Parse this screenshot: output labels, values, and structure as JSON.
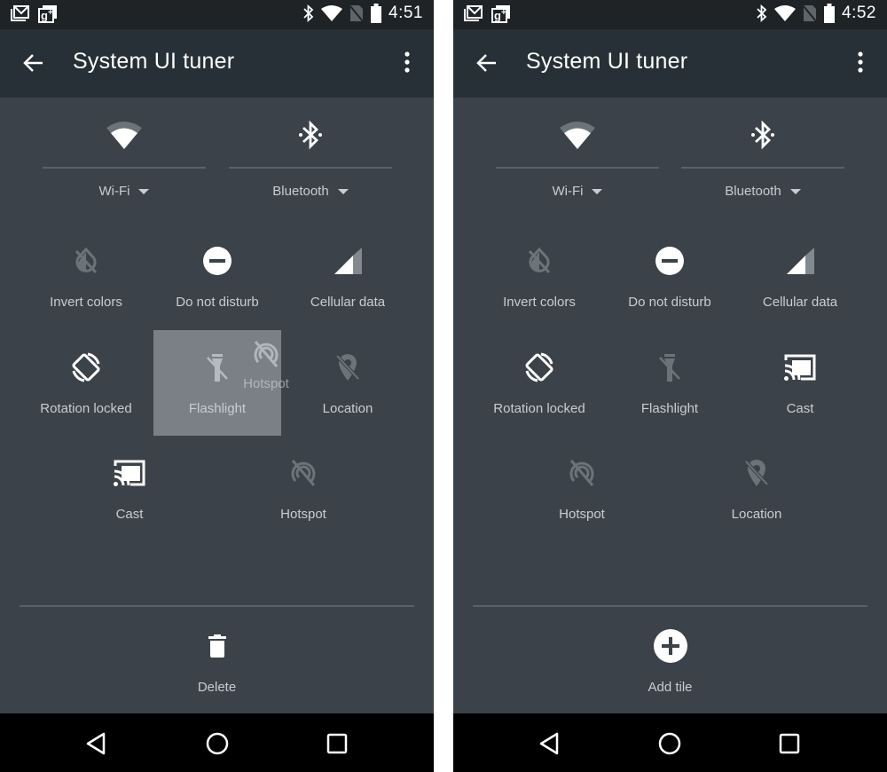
{
  "screens": [
    {
      "statusbar": {
        "time": "4:51",
        "notification_icons": [
          "gmail-icon",
          "google-plus-icon"
        ],
        "status_icons": [
          "bluetooth-icon",
          "wifi-icon",
          "no-sim-icon",
          "battery-icon"
        ]
      },
      "toolbar": {
        "title": "System UI tuner",
        "back_icon": "arrow-back-icon",
        "menu_icon": "more-vert-icon"
      },
      "big_tiles": [
        {
          "label": "Wi-Fi",
          "icon": "wifi-icon"
        },
        {
          "label": "Bluetooth",
          "icon": "bluetooth-icon"
        }
      ],
      "tiles": [
        {
          "label": "Invert colors",
          "icon": "invert-colors-off-icon",
          "active": false
        },
        {
          "label": "Do not disturb",
          "icon": "do-not-disturb-icon",
          "active": true
        },
        {
          "label": "Cellular data",
          "icon": "cellular-signal-icon",
          "active": true
        },
        {
          "label": "Rotation locked",
          "icon": "screen-rotation-icon",
          "active": true
        },
        {
          "label": "Flashlight",
          "icon": "flashlight-off-icon",
          "active": false,
          "selected": true
        },
        {
          "label": "Location",
          "icon": "location-off-icon",
          "active": false
        },
        {
          "label": "Cast",
          "icon": "cast-icon",
          "active": true
        },
        {
          "label": "Hotspot",
          "icon": "hotspot-off-icon",
          "active": false
        }
      ],
      "dragging_tile": {
        "label": "Hotspot",
        "icon": "hotspot-off-icon"
      },
      "bottom_action": {
        "label": "Delete",
        "icon": "delete-icon"
      },
      "navbar": {
        "back": "nav-back-icon",
        "home": "nav-home-icon",
        "recents": "nav-recents-icon"
      }
    },
    {
      "statusbar": {
        "time": "4:52",
        "notification_icons": [
          "gmail-icon",
          "google-plus-icon"
        ],
        "status_icons": [
          "bluetooth-icon",
          "wifi-icon",
          "no-sim-icon",
          "battery-icon"
        ]
      },
      "toolbar": {
        "title": "System UI tuner",
        "back_icon": "arrow-back-icon",
        "menu_icon": "more-vert-icon"
      },
      "big_tiles": [
        {
          "label": "Wi-Fi",
          "icon": "wifi-icon"
        },
        {
          "label": "Bluetooth",
          "icon": "bluetooth-icon"
        }
      ],
      "tiles": [
        {
          "label": "Invert colors",
          "icon": "invert-colors-off-icon",
          "active": false
        },
        {
          "label": "Do not disturb",
          "icon": "do-not-disturb-icon",
          "active": true
        },
        {
          "label": "Cellular data",
          "icon": "cellular-signal-icon",
          "active": true
        },
        {
          "label": "Rotation locked",
          "icon": "screen-rotation-icon",
          "active": true
        },
        {
          "label": "Flashlight",
          "icon": "flashlight-off-icon",
          "active": false
        },
        {
          "label": "Cast",
          "icon": "cast-icon",
          "active": true
        },
        {
          "label": "Hotspot",
          "icon": "hotspot-off-icon",
          "active": false
        },
        {
          "label": "Location",
          "icon": "location-off-icon",
          "active": false
        }
      ],
      "bottom_action": {
        "label": "Add tile",
        "icon": "add-circle-icon"
      },
      "navbar": {
        "back": "nav-back-icon",
        "home": "nav-home-icon",
        "recents": "nav-recents-icon"
      }
    }
  ]
}
